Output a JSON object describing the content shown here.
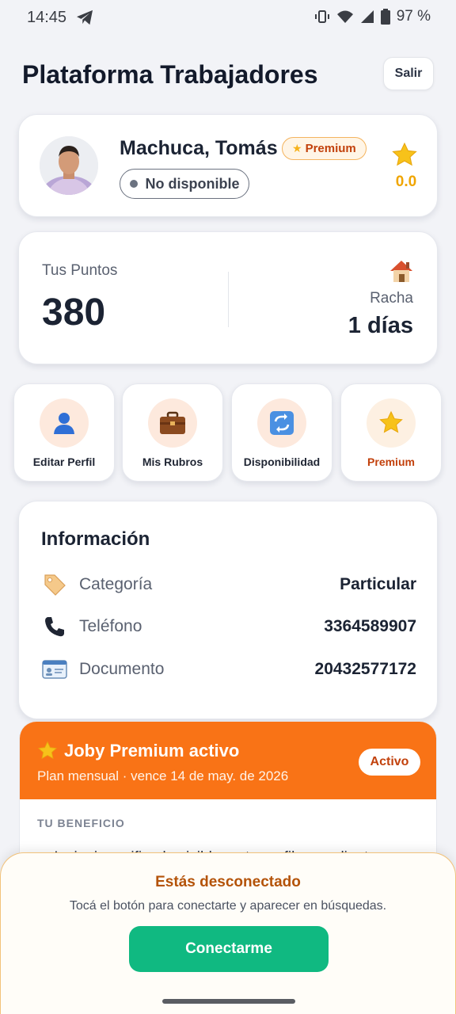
{
  "status_bar": {
    "time": "14:45",
    "battery": "97 %",
    "icons": [
      "telegram-icon",
      "vibrate-icon",
      "wifi-icon",
      "signal-icon",
      "battery-icon"
    ]
  },
  "header": {
    "title": "Plataforma Trabajadores",
    "logout_label": "Salir"
  },
  "profile": {
    "name": "Machuca, Tomás",
    "badge": "Premium",
    "availability": "No disponible",
    "rating": "0.0"
  },
  "points": {
    "label": "Tus Puntos",
    "value": "380",
    "streak_label": "Racha",
    "streak_value": "1 días"
  },
  "actions": [
    {
      "label": "Editar Perfil",
      "icon": "user-icon"
    },
    {
      "label": "Mis Rubros",
      "icon": "briefcase-icon"
    },
    {
      "label": "Disponibilidad",
      "icon": "refresh-icon"
    },
    {
      "label": "Premium",
      "icon": "star-icon"
    }
  ],
  "info": {
    "title": "Información",
    "rows": [
      {
        "key": "Categoría",
        "value": "Particular",
        "icon": "tag-icon"
      },
      {
        "key": "Teléfono",
        "value": "3364589907",
        "icon": "phone-icon"
      },
      {
        "key": "Documento",
        "value": "20432577172",
        "icon": "id-card-icon"
      }
    ]
  },
  "premium": {
    "title": "Joby Premium activo",
    "subtitle": "Plan mensual · vence 14 de may. de 2026",
    "status": "Activo",
    "benefit_heading": "TU BENEFICIO",
    "benefit_text": "✓ Insignia verificada visible en tu perfil para clientes"
  },
  "sheet": {
    "title": "Estás desconectado",
    "subtitle": "Tocá el botón para conectarte y aparecer en búsquedas.",
    "button": "Conectarme"
  },
  "colors": {
    "accent": "#f97316",
    "connect": "#10b981",
    "rating": "#f0a500"
  }
}
